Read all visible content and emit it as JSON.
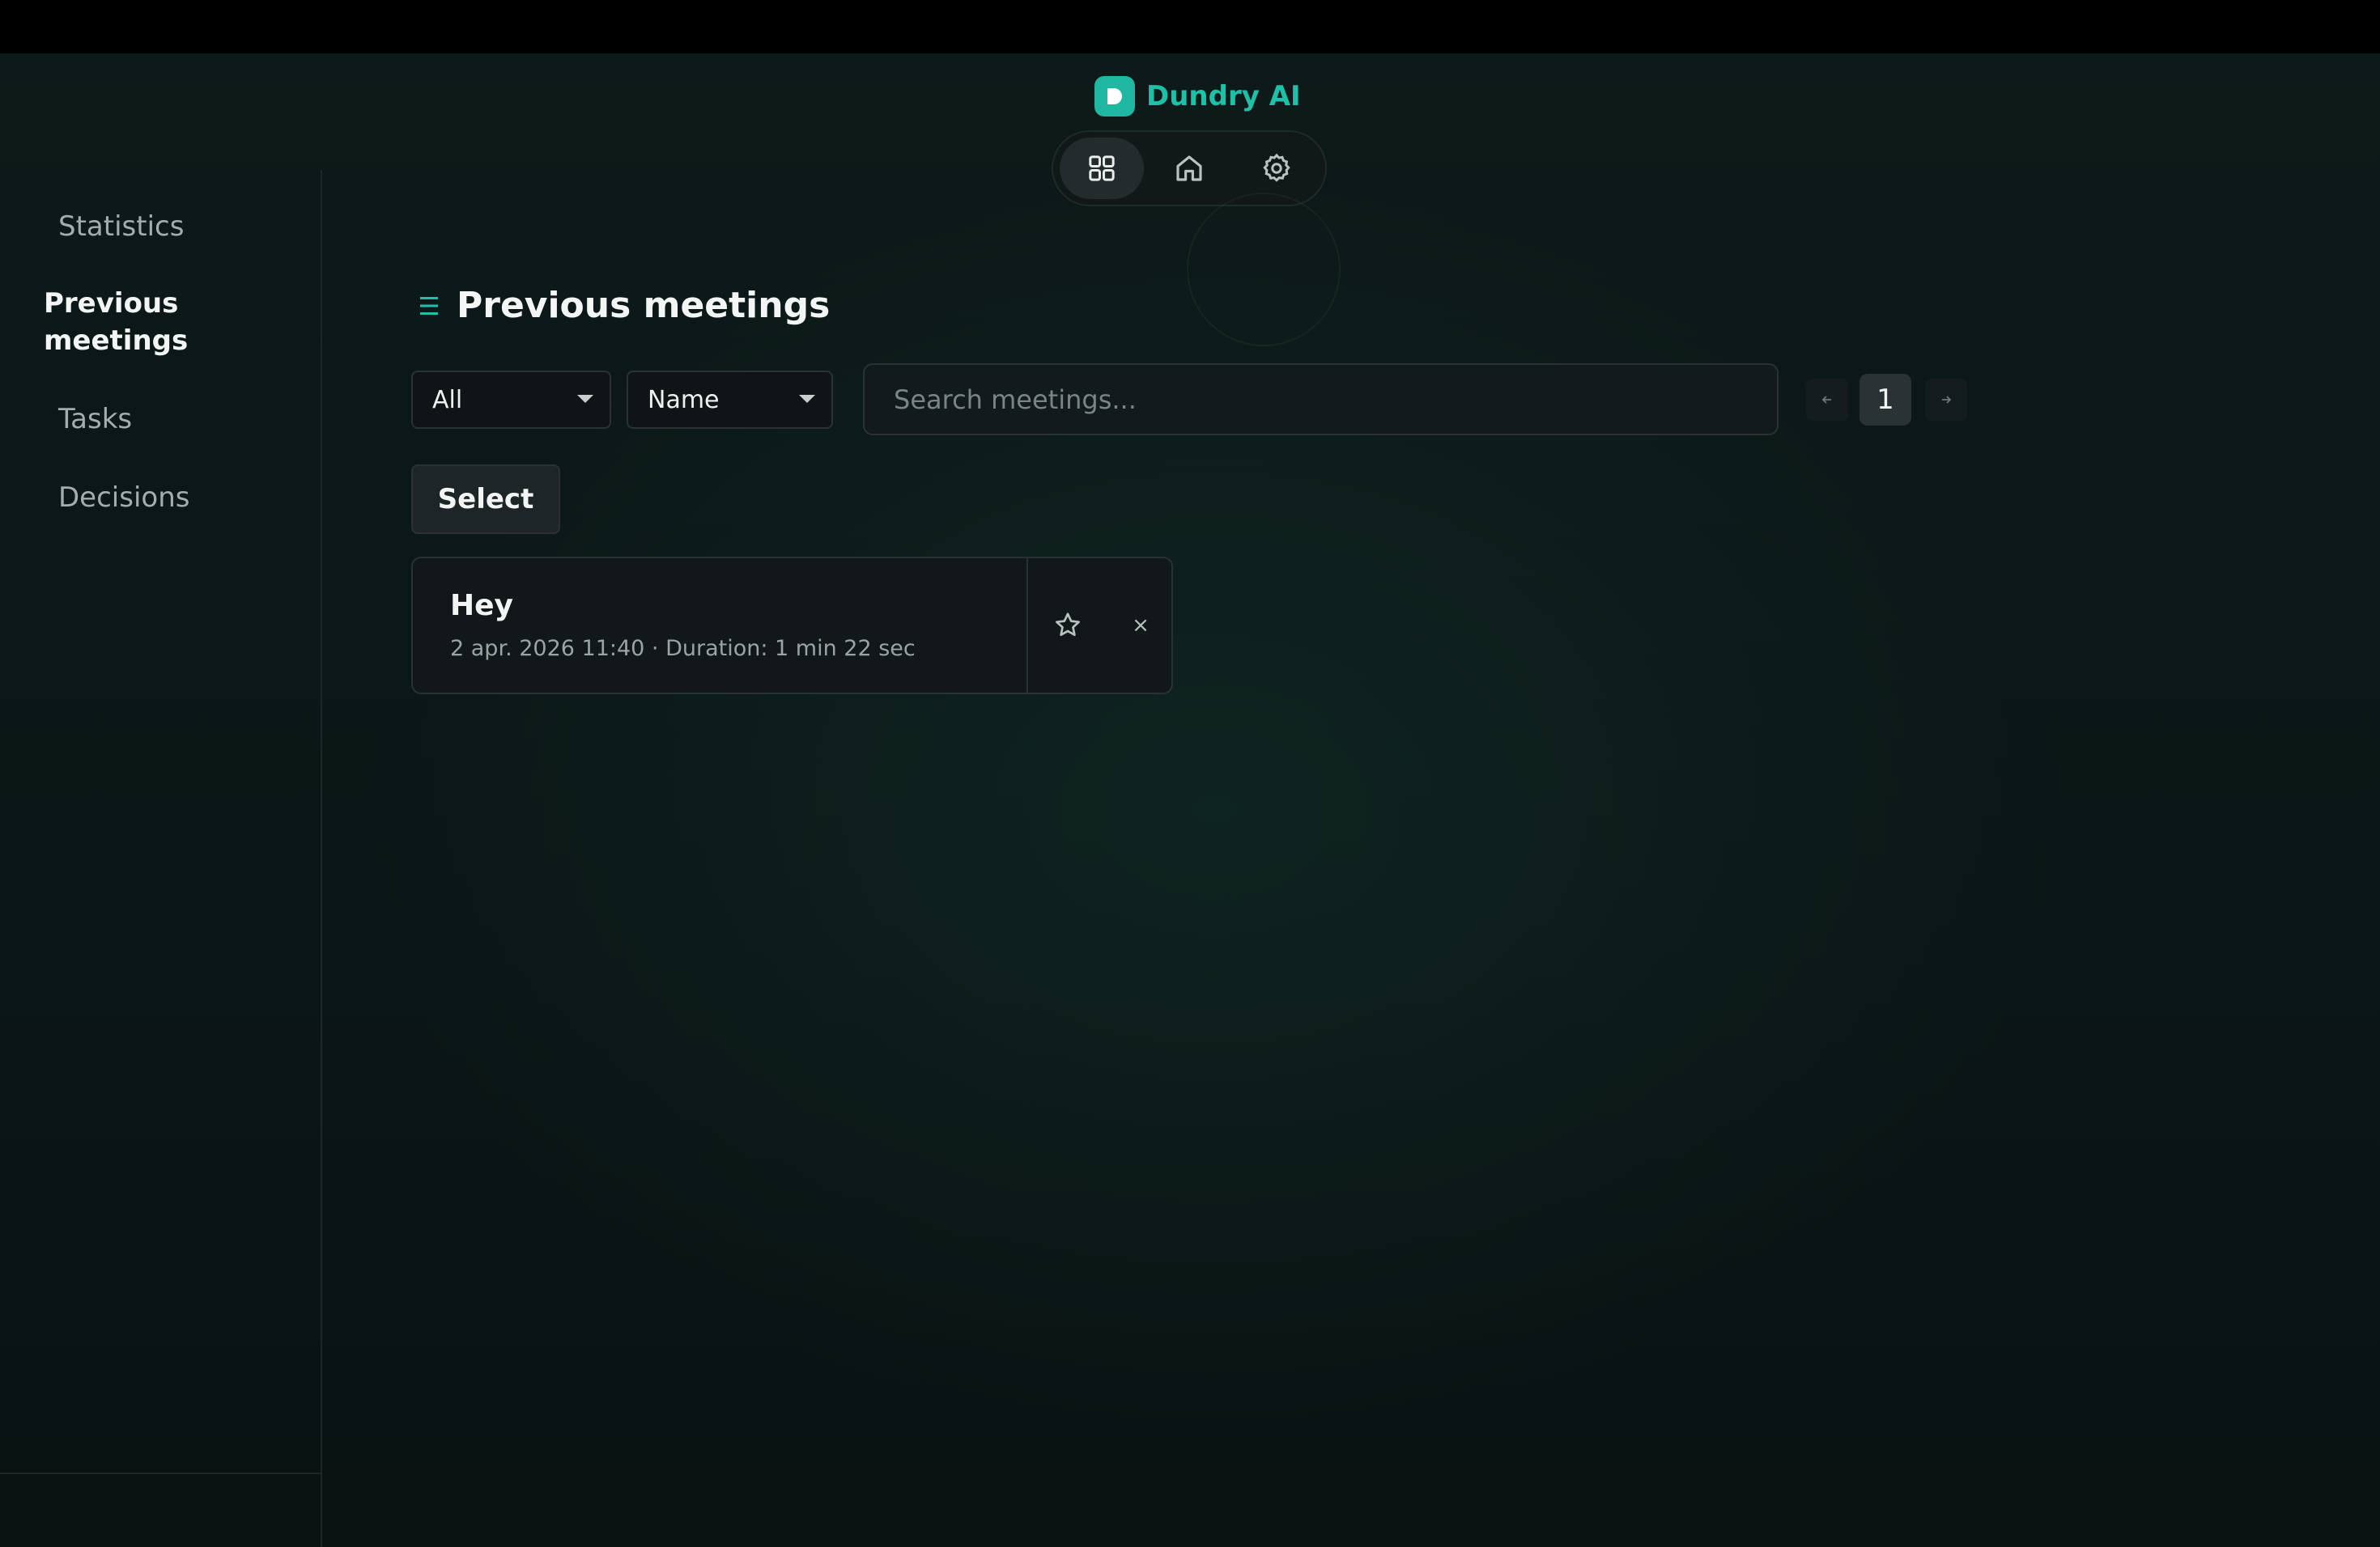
{
  "app": {
    "name": "Dundry AI",
    "accent_color": "#1fc0a8"
  },
  "icon_nav": {
    "items": [
      {
        "icon": "grid-icon",
        "active": true
      },
      {
        "icon": "home-icon",
        "active": false
      },
      {
        "icon": "gear-icon",
        "active": false
      }
    ]
  },
  "sidebar": {
    "items": [
      {
        "label": "Statistics",
        "active": false
      },
      {
        "label": "Previous meetings",
        "active": true
      },
      {
        "label": "Tasks",
        "active": false
      },
      {
        "label": "Decisions",
        "active": false
      }
    ]
  },
  "main": {
    "title": "Previous meetings",
    "title_icon": "list-icon",
    "filter_select": {
      "value": "All"
    },
    "sort_select": {
      "value": "Name"
    },
    "search": {
      "placeholder": "Search meetings...",
      "value": ""
    },
    "pagination": {
      "current_page": "1",
      "prev_icon": "arrow-left-icon",
      "next_icon": "arrow-right-icon"
    },
    "select_button": "Select",
    "meetings": [
      {
        "title": "Hey",
        "meta": "2 apr. 2026 11:40 · Duration: 1 min 22 sec",
        "favorite_icon": "star-icon",
        "delete_label": "×"
      }
    ]
  }
}
